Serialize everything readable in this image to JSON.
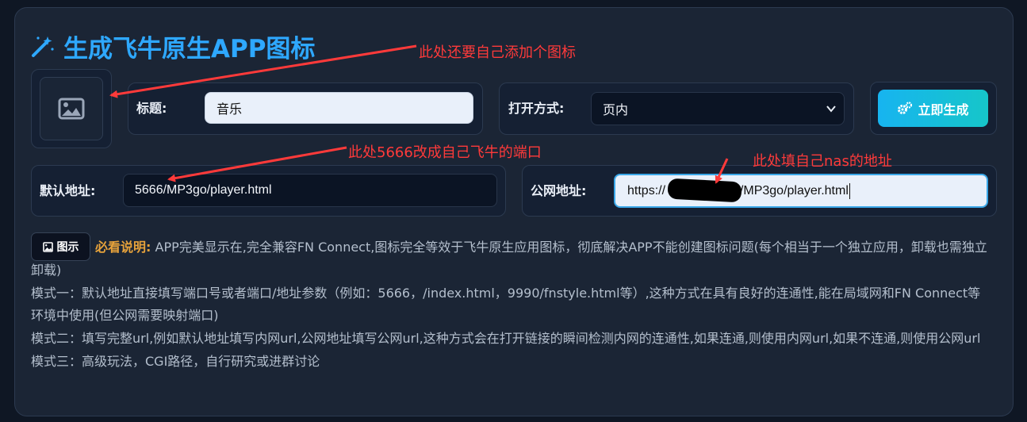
{
  "header": {
    "title": "生成飞牛原生APP图标"
  },
  "icon_picker": {
    "icon": "image-icon"
  },
  "form": {
    "title_label": "标题:",
    "title_value": "音乐",
    "open_mode_label": "打开方式:",
    "open_mode_value": "页内",
    "generate_label": "立即生成",
    "default_addr_label": "默认地址:",
    "default_addr_value": "5666/MP3go/player.html",
    "public_addr_label": "公网地址:",
    "public_addr_value_prefix": "https://",
    "public_addr_value_suffix": "6/MP3go/player.html"
  },
  "help": {
    "show_label": "图示",
    "must_read": "必看说明:",
    "line1": "APP完美显示在,完全兼容FN Connect,图标完全等效于飞牛原生应用图标，彻底解决APP不能创建图标问题(每个相当于一个独立应用，卸载也需独立卸载)",
    "line2": "模式一：默认地址直接填写端口号或者端口/地址参数（例如：5666，/index.html，9990/fnstyle.html等）,这种方式在具有良好的连通性,能在局域网和FN Connect等环境中使用(但公网需要映射端口)",
    "line3": "模式二：填写完整url,例如默认地址填写内网url,公网地址填写公网url,这种方式会在打开链接的瞬间检测内网的连通性,如果连通,则使用内网url,如果不连通,则使用公网url",
    "line4": "模式三：高级玩法，CGI路径，自行研究或进群讨论"
  },
  "annotations": {
    "icon_note": "此处还要自己添加个图标",
    "port_note": "此处5666改成自己飞牛的端口",
    "nas_note": "此处填自己nas的地址"
  },
  "colors": {
    "accent": "#2ea8ff",
    "annotation": "#ff3a3a",
    "must_read": "#e8a33b",
    "button_gradient_start": "#17b4f0",
    "button_gradient_end": "#16c6c9"
  }
}
